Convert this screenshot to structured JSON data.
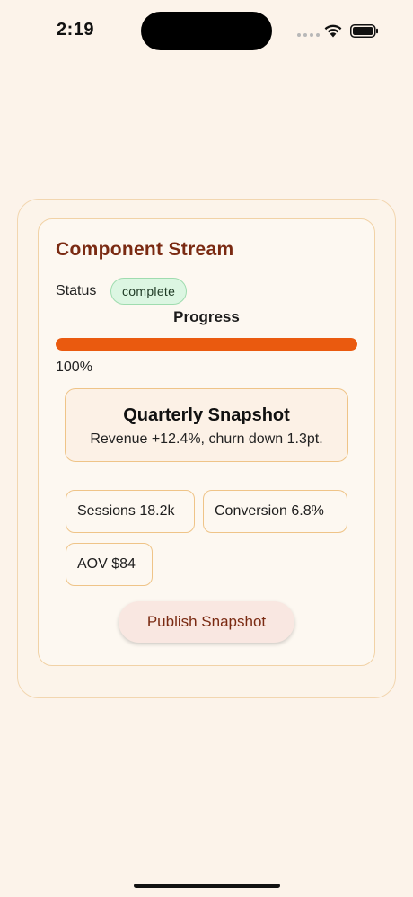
{
  "status_bar": {
    "time": "2:19",
    "icons": [
      "cellular-signal-icon",
      "wifi-icon",
      "battery-icon"
    ]
  },
  "card": {
    "title": "Component Stream",
    "status_label": "Status",
    "status_badge": "complete",
    "progress_label": "Progress",
    "progress_value": 1.0,
    "progress_text": "100%",
    "snapshot": {
      "title": "Quarterly Snapshot",
      "subtitle": "Revenue +12.4%, churn down 1.3pt."
    },
    "metrics": [
      "Sessions 18.2k",
      "Conversion 6.8%",
      "AOV $84"
    ],
    "publish_button": "Publish Snapshot"
  },
  "colors": {
    "background": "#fcf3ea",
    "title": "#7a2a12",
    "progress_fill": "#ea5a0f",
    "badge_bg": "#dcf6e2",
    "badge_border": "#9fdcaf",
    "card_border": "#efc488"
  }
}
